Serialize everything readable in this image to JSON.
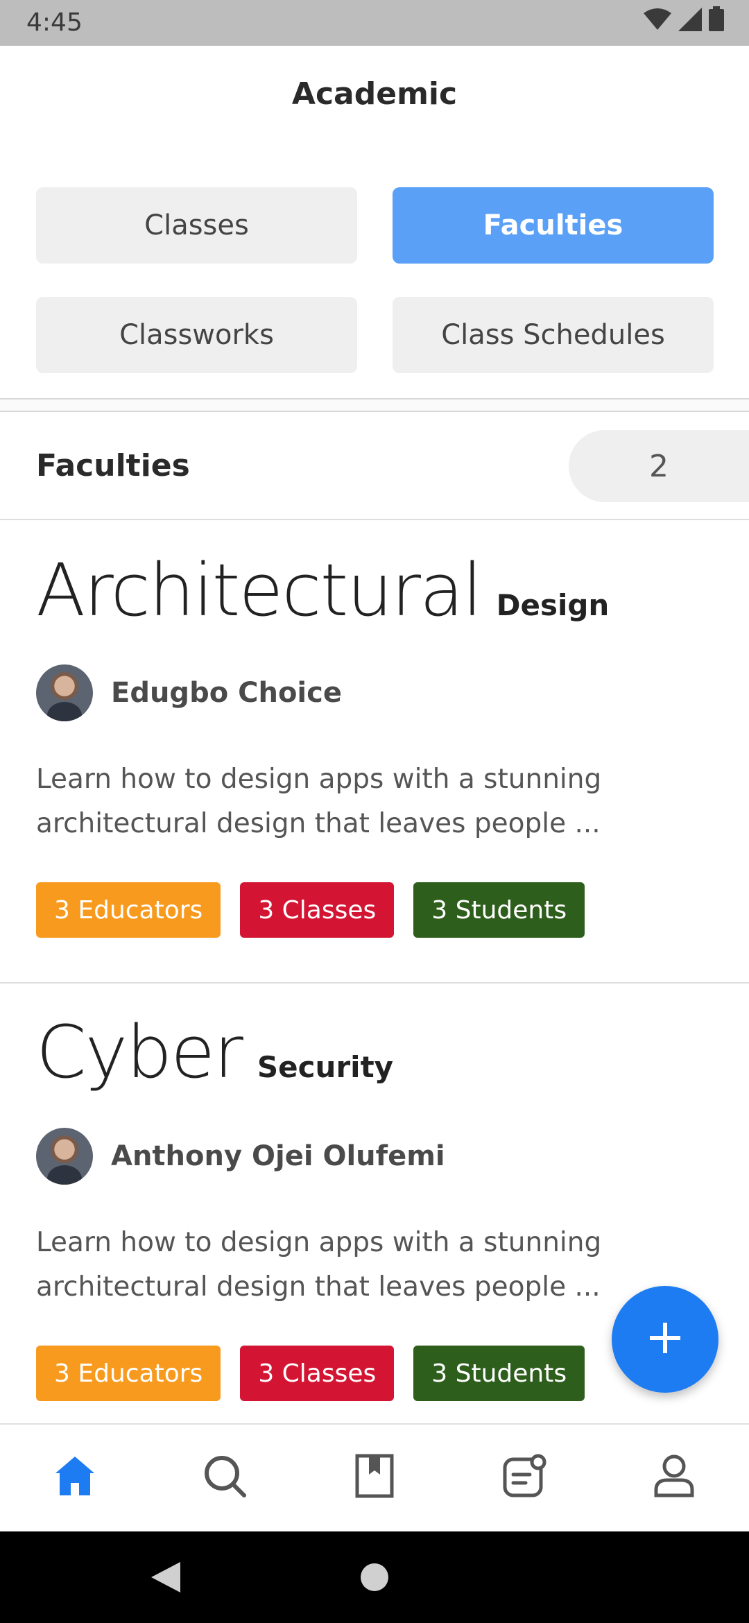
{
  "status_bar": {
    "time": "4:45"
  },
  "header": {
    "title": "Academic"
  },
  "tabs": [
    {
      "label": "Classes",
      "active": false
    },
    {
      "label": "Faculties",
      "active": true
    },
    {
      "label": "Classworks",
      "active": false
    },
    {
      "label": "Class Schedules",
      "active": false
    }
  ],
  "list": {
    "title": "Faculties",
    "count": "2"
  },
  "faculties": [
    {
      "title_big": "Architectural",
      "title_small": "Design",
      "author": "Edugbo Choice",
      "description": "Learn how to design apps with a stunning architectural design that leaves people ...",
      "tags": [
        "3 Educators",
        "3 Classes",
        "3 Students"
      ]
    },
    {
      "title_big": "Cyber",
      "title_small": "Security",
      "author": "Anthony Ojei Olufemi",
      "description": "Learn how to design apps with a stunning architectural design that leaves people ...",
      "tags": [
        "3 Educators",
        "3 Classes",
        "3 Students"
      ]
    }
  ],
  "bottom_nav": [
    "home-icon",
    "search-icon",
    "bookmark-icon",
    "notes-icon",
    "profile-icon"
  ],
  "colors": {
    "accent": "#5aa0f7",
    "fab": "#1e7cf2",
    "educators": "#f79a1e",
    "classes": "#d31533",
    "students": "#2d5e1c"
  }
}
